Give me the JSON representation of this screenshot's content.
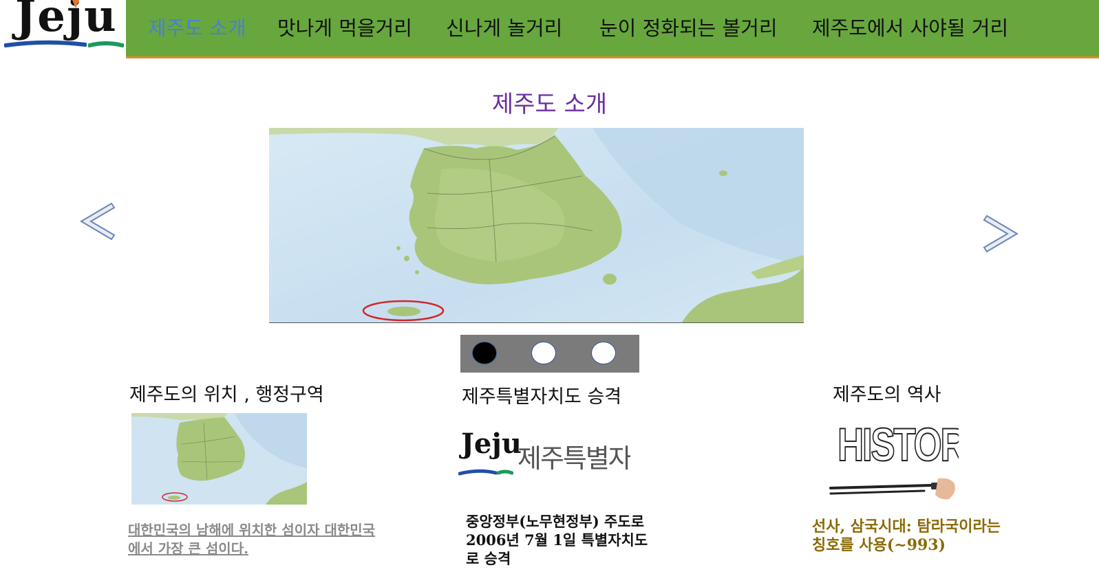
{
  "header": {
    "logo_text": "Jeju",
    "nav": [
      {
        "label": "제주도 소개",
        "active": true
      },
      {
        "label": "맛나게 먹을거리",
        "active": false
      },
      {
        "label": "신나게 놀거리",
        "active": false
      },
      {
        "label": "눈이 정화되는 볼거리",
        "active": false
      },
      {
        "label": "제주도에서 사야될 거리",
        "active": false
      }
    ]
  },
  "main": {
    "title": "제주도 소개",
    "carousel": {
      "current_slide": 1,
      "total_slides": 3,
      "prev_icon": "chevron-left-icon",
      "next_icon": "chevron-right-icon"
    },
    "cards": [
      {
        "title": "제주도의 위치 , 행정구역",
        "desc": "대한민국의 남해에 위치한 섬이자 대한민국에서 가장 큰 섬이다."
      },
      {
        "title": "제주특별자치도 승격",
        "logo_word": "Jeju",
        "logo_label": "제주특별자치도",
        "desc": "중앙정부(노무현정부) 주도로 2006년 7월 1일 특별자치도로 승격"
      },
      {
        "title": "제주도의 역사",
        "image_word": "HISTORY",
        "desc": "선사, 삼국시대: 탐라국이라는 칭호를 사용(~993)"
      }
    ]
  },
  "colors": {
    "nav_bg": "#67a73e",
    "nav_border": "#e08a2c",
    "nav_active": "#4a7fd4",
    "title": "#6a2ea1",
    "dots_bg": "#7b7b7b"
  }
}
